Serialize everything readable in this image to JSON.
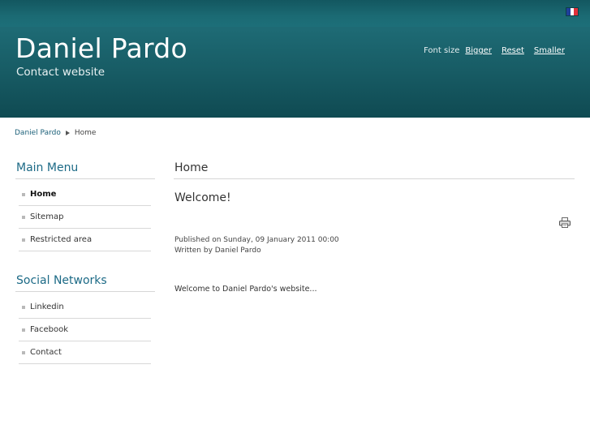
{
  "colors": {
    "header_bg": "#185d66",
    "link": "#1a5f78",
    "module_title": "#1c6a86"
  },
  "language": {
    "icon": "french-flag-icon",
    "flag_colors": [
      "#1f3f9a",
      "#ffffff",
      "#e0303a"
    ]
  },
  "header": {
    "title": "Daniel Pardo",
    "subtitle": "Contact website",
    "font_size": {
      "label": "Font size",
      "bigger": "Bigger",
      "reset": "Reset",
      "smaller": "Smaller"
    }
  },
  "breadcrumb": {
    "root": "Daniel Pardo",
    "current": "Home"
  },
  "main_menu": {
    "title": "Main Menu",
    "items": [
      {
        "label": "Home",
        "active": true
      },
      {
        "label": "Sitemap"
      },
      {
        "label": "Restricted area"
      }
    ]
  },
  "social": {
    "title": "Social Networks",
    "items": [
      {
        "label": "Linkedin"
      },
      {
        "label": "Facebook"
      },
      {
        "label": "Contact"
      }
    ]
  },
  "content": {
    "page_title": "Home",
    "article_title": "Welcome!",
    "print_icon": "printer-icon",
    "published": "Published on Sunday, 09 January 2011 00:00",
    "written_by": "Written by Daniel Pardo",
    "body": "Welcome to Daniel Pardo's website..."
  }
}
